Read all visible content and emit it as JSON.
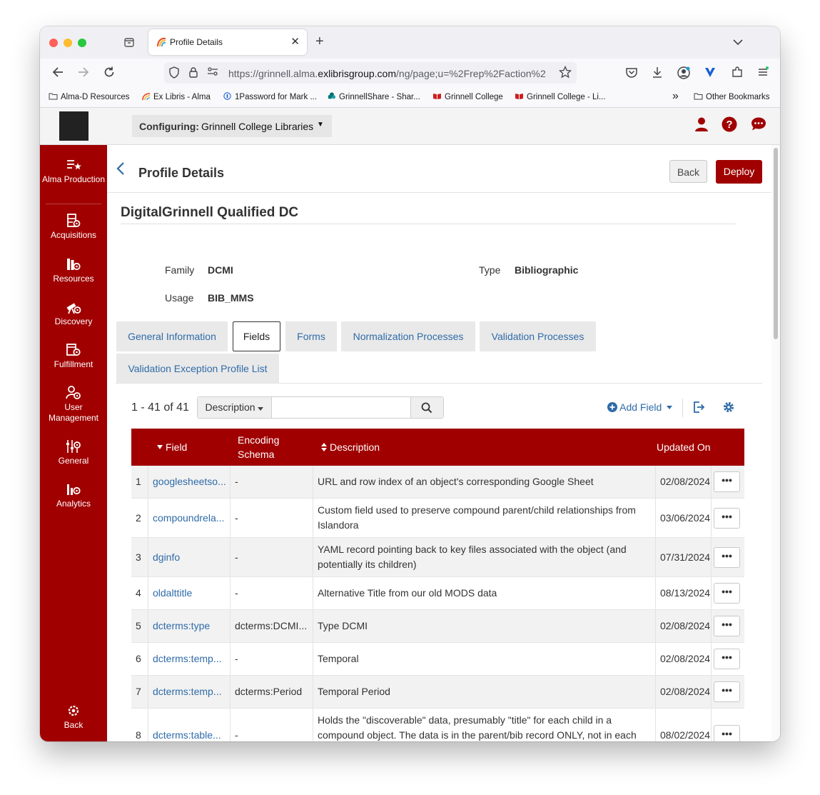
{
  "browser": {
    "tab_title": "Profile Details",
    "tab_close": "✕",
    "new_tab": "+",
    "url_prefix": "https://grinnell.alma.",
    "url_domain": "exlibrisgroup.com",
    "url_suffix": "/ng/page;u=%2Frep%2Faction%2",
    "bookmarks": [
      "Alma-D Resources",
      "Ex Libris - Alma",
      "1Password for Mark ...",
      "GrinnellShare - Shar...",
      "Grinnell College",
      "Grinnell College - Li...",
      "Other Bookmarks"
    ],
    "bookmarks_overflow": "»"
  },
  "header": {
    "config_label": "Configuring:",
    "config_value": "Grinnell College Libraries",
    "config_caret": "▼"
  },
  "sidebar": {
    "items": [
      {
        "label": "Alma Production",
        "icon": "alma-production-icon"
      },
      {
        "label": "Acquisitions",
        "icon": "acquisitions-icon"
      },
      {
        "label": "Resources",
        "icon": "resources-icon"
      },
      {
        "label": "Discovery",
        "icon": "discovery-icon"
      },
      {
        "label": "Fulfillment",
        "icon": "fulfillment-icon"
      },
      {
        "label": "User Management",
        "icon": "user-management-icon"
      },
      {
        "label": "General",
        "icon": "general-icon"
      },
      {
        "label": "Analytics",
        "icon": "analytics-icon"
      }
    ],
    "back_label": "Back"
  },
  "page": {
    "title": "Profile Details",
    "back_button": "Back",
    "deploy_button": "Deploy",
    "profile_name": "DigitalGrinnell Qualified DC",
    "family_label": "Family",
    "family_value": "DCMI",
    "type_label": "Type",
    "type_value": "Bibliographic",
    "usage_label": "Usage",
    "usage_value": "BIB_MMS",
    "tabs": [
      "General Information",
      "Fields",
      "Forms",
      "Normalization Processes",
      "Validation Processes",
      "Validation Exception Profile List"
    ],
    "active_tab": "Fields"
  },
  "toolbar": {
    "count": "1 - 41 of 41",
    "search_scope": "Description",
    "search_placeholder": "",
    "add_field": "Add Field"
  },
  "table": {
    "headers": {
      "field": "Field",
      "encoding": "Encoding Schema",
      "description": "Description",
      "updated": "Updated On"
    },
    "row_action": "•••",
    "rows": [
      {
        "num": "1",
        "field": "googlesheetso...",
        "encoding": "-",
        "description": "URL and row index of an object's corresponding Google Sheet",
        "updated": "02/08/2024"
      },
      {
        "num": "2",
        "field": "compoundrela...",
        "encoding": "-",
        "description": "Custom field used to preserve compound parent/child relationships from Islandora",
        "updated": "03/06/2024"
      },
      {
        "num": "3",
        "field": "dginfo",
        "encoding": "-",
        "description": "YAML record pointing back to key files associated with the object (and potentially its children)",
        "updated": "07/31/2024"
      },
      {
        "num": "4",
        "field": "oldalttitle",
        "encoding": "-",
        "description": "Alternative Title from our old MODS data",
        "updated": "08/13/2024"
      },
      {
        "num": "5",
        "field": "dcterms:type",
        "encoding": "dcterms:DCMI...",
        "description": "Type DCMI",
        "updated": "02/08/2024"
      },
      {
        "num": "6",
        "field": "dcterms:temp...",
        "encoding": "-",
        "description": "Temporal",
        "updated": "02/08/2024"
      },
      {
        "num": "7",
        "field": "dcterms:temp...",
        "encoding": "dcterms:Period",
        "description": "Temporal Period",
        "updated": "02/08/2024"
      },
      {
        "num": "8",
        "field": "dcterms:table...",
        "encoding": "-",
        "description": "Holds the \"discoverable\" data, presumably \"title\" for each child in a compound object. The data is in the parent/bib record ONLY, not in each child/digital item.",
        "updated": "08/02/2024"
      }
    ]
  },
  "colors": {
    "brand": "#a00000",
    "link": "#2f6ba8"
  }
}
